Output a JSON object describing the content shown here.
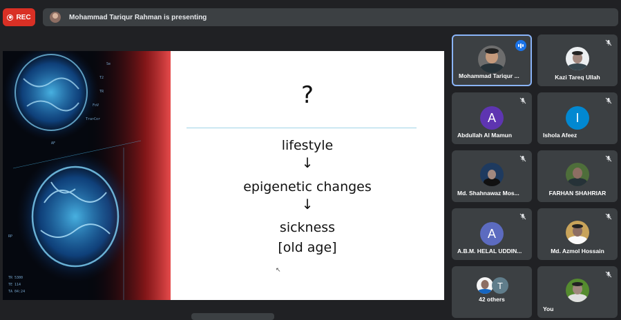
{
  "recording": {
    "label": "REC"
  },
  "presenting": {
    "text": "Mohammad Tariqur Rahman is presenting"
  },
  "slide": {
    "question_mark": "?",
    "lines": [
      "lifestyle",
      "↓",
      "epigenetic changes",
      "↓",
      "sickness",
      "[old age]"
    ]
  },
  "participants": [
    {
      "name": "Mohammad Tariqur ...",
      "avatar_type": "photo",
      "status": "speaking"
    },
    {
      "name": "Kazi Tareq Ullah",
      "avatar_type": "photo",
      "status": "muted"
    },
    {
      "name": "Abdullah Al Mamun",
      "avatar_type": "letter",
      "initial": "A",
      "color": "#5e35b1",
      "status": "muted"
    },
    {
      "name": "Ishola Afeez",
      "avatar_type": "letter",
      "initial": "I",
      "color": "#0288d1",
      "status": "muted"
    },
    {
      "name": "Md. Shahnawaz Mos...",
      "avatar_type": "photo",
      "status": "muted"
    },
    {
      "name": "FARHAN SHAHRIAR",
      "avatar_type": "photo",
      "status": "muted"
    },
    {
      "name": "A.B.M. HELAL UDDIN...",
      "avatar_type": "letter",
      "initial": "A",
      "color": "#5c6bc0",
      "status": "muted"
    },
    {
      "name": "Md. Azmol Hossain",
      "avatar_type": "photo",
      "status": "muted"
    },
    {
      "name": "42 others",
      "avatar_type": "group",
      "initial": "T",
      "status": "none"
    },
    {
      "name": "You",
      "avatar_type": "photo",
      "status": "muted"
    }
  ],
  "colors": {
    "active_border": "#8ab4f8",
    "rec_red": "#d93025",
    "tile_bg": "#3c4043",
    "speaking_blue": "#1a73e8"
  },
  "icons": [
    "record-icon",
    "mic-off-icon",
    "speaking-indicator-icon"
  ]
}
